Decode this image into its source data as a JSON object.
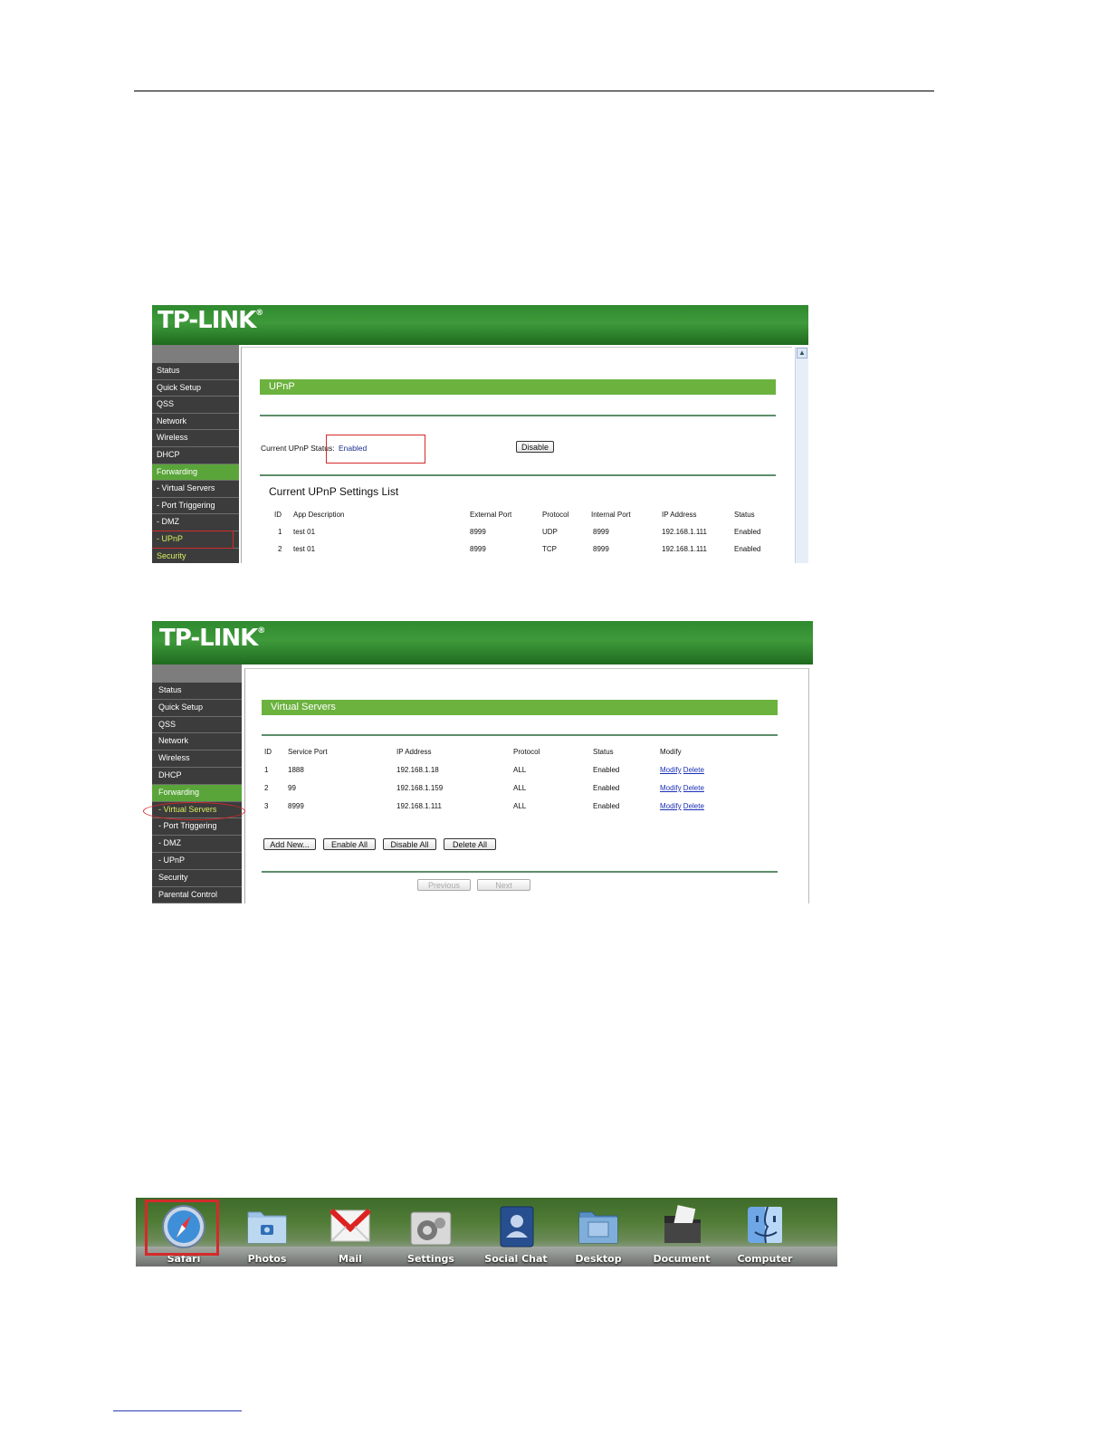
{
  "upnp_screen": {
    "logo": "TP-LINK",
    "logo_mark": "®",
    "scroll_up": "▲",
    "sidebar": [
      "Status",
      "Quick Setup",
      "QSS",
      "Network",
      "Wireless",
      "DHCP",
      "Forwarding",
      "- Virtual Servers",
      "- Port Triggering",
      "- DMZ",
      "- UPnP",
      "Security"
    ],
    "section_title": "UPnP",
    "status_label": "Current UPnP Status:",
    "status_value": "Enabled",
    "disable_button": "Disable",
    "list_title": "Current UPnP Settings List",
    "columns": [
      "ID",
      "App Description",
      "External Port",
      "Protocol",
      "Internal Port",
      "IP Address",
      "Status"
    ],
    "rows": [
      [
        "1",
        "test 01",
        "8999",
        "UDP",
        "8999",
        "192.168.1.111",
        "Enabled"
      ],
      [
        "2",
        "test 01",
        "8999",
        "TCP",
        "8999",
        "192.168.1.111",
        "Enabled"
      ]
    ]
  },
  "virtual_servers_screen": {
    "logo": "TP-LINK",
    "logo_mark": "®",
    "sidebar": [
      "Status",
      "Quick Setup",
      "QSS",
      "Network",
      "Wireless",
      "DHCP",
      "Forwarding",
      "- Virtual Servers",
      "- Port Triggering",
      "- DMZ",
      "- UPnP",
      "Security",
      "Parental Control"
    ],
    "section_title": "Virtual Servers",
    "columns": [
      "ID",
      "Service Port",
      "IP Address",
      "Protocol",
      "Status",
      "Modify"
    ],
    "rows": [
      [
        "1",
        "1888",
        "192.168.1.18",
        "ALL",
        "Enabled"
      ],
      [
        "2",
        "99",
        "192.168.1.159",
        "ALL",
        "Enabled"
      ],
      [
        "3",
        "8999",
        "192.168.1.111",
        "ALL",
        "Enabled"
      ]
    ],
    "modify_link": "Modify",
    "delete_link": "Delete",
    "buttons": {
      "add_new": "Add New...",
      "enable_all": "Enable All",
      "disable_all": "Disable All",
      "delete_all": "Delete All"
    },
    "pager": {
      "previous": "Previous",
      "next": "Next"
    }
  },
  "dock": {
    "items": [
      {
        "label": "Safari",
        "icon": "safari-compass-icon"
      },
      {
        "label": "Photos",
        "icon": "photos-folder-icon"
      },
      {
        "label": "Mail",
        "icon": "gmail-envelope-icon"
      },
      {
        "label": "Settings",
        "icon": "settings-gear-icon"
      },
      {
        "label": "Social Chat",
        "icon": "contacts-book-icon"
      },
      {
        "label": "Desktop",
        "icon": "desktop-folder-icon"
      },
      {
        "label": "Document",
        "icon": "document-folder-icon"
      },
      {
        "label": "Computer",
        "icon": "finder-face-icon"
      }
    ]
  },
  "colors": {
    "banner_green": "#2f8a2f",
    "section_green": "#6cb23f",
    "highlight_red": "#d42a2a",
    "link_blue": "#1a2fb5"
  }
}
